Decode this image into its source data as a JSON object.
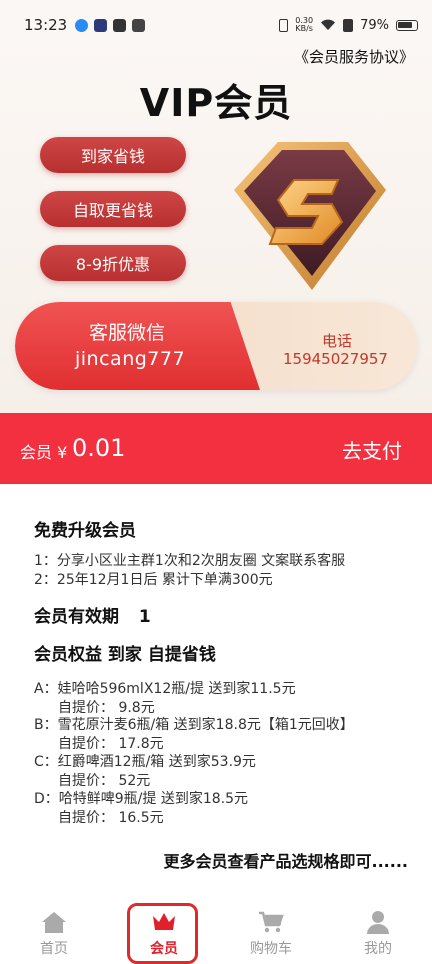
{
  "status_bar": {
    "time": "13:23",
    "net_speed_value": "0.30",
    "net_speed_unit": "KB/s",
    "battery": "79%"
  },
  "header": {
    "agreement_link": "《会员服务协议》",
    "title": "VIP会员"
  },
  "benefit_pills": [
    "到家省钱",
    "自取更省钱",
    "8-9折优惠"
  ],
  "customer_service": {
    "wechat_label": "客服微信",
    "wechat_id": "jincang777",
    "phone_label": "电话",
    "phone_number": "15945027957"
  },
  "payment": {
    "price_label": "会员 ¥",
    "price": "0.01",
    "pay_button": "去支付"
  },
  "details": {
    "upgrade_title": "免费升级会员",
    "upgrade_items": [
      "1：分享小区业主群1次和2次朋友圈  文案联系客服",
      "2：25年12月1日后 累计下单满300元"
    ],
    "validity_label": "会员有效期",
    "validity_value": "1",
    "rights_title": "会员权益   到家 自提省钱",
    "rights": [
      {
        "line": "A：娃哈哈596mlX12瓶/提  送到家11.5元",
        "pickup": "自提价：  9.8元"
      },
      {
        "line": "B：雪花原汁麦6瓶/箱  送到家18.8元【箱1元回收】",
        "pickup": "自提价：  17.8元"
      },
      {
        "line": "C：红爵啤酒12瓶/箱  送到家53.9元",
        "pickup": "自提价：  52元"
      },
      {
        "line": "D：哈特鲜啤9瓶/提  送到家18.5元",
        "pickup": "自提价：  16.5元"
      }
    ],
    "more_text": "更多会员查看产品选规格即可......"
  },
  "bottom_nav": {
    "items": [
      {
        "label": "首页",
        "icon": "home-icon"
      },
      {
        "label": "会员",
        "icon": "crown-icon"
      },
      {
        "label": "购物车",
        "icon": "cart-icon"
      },
      {
        "label": "我的",
        "icon": "user-icon"
      }
    ],
    "active": "会员"
  },
  "colors": {
    "accent_red": "#f2303f",
    "pill_red": "#c43a3a",
    "badge_gold": "#e9a23b"
  }
}
